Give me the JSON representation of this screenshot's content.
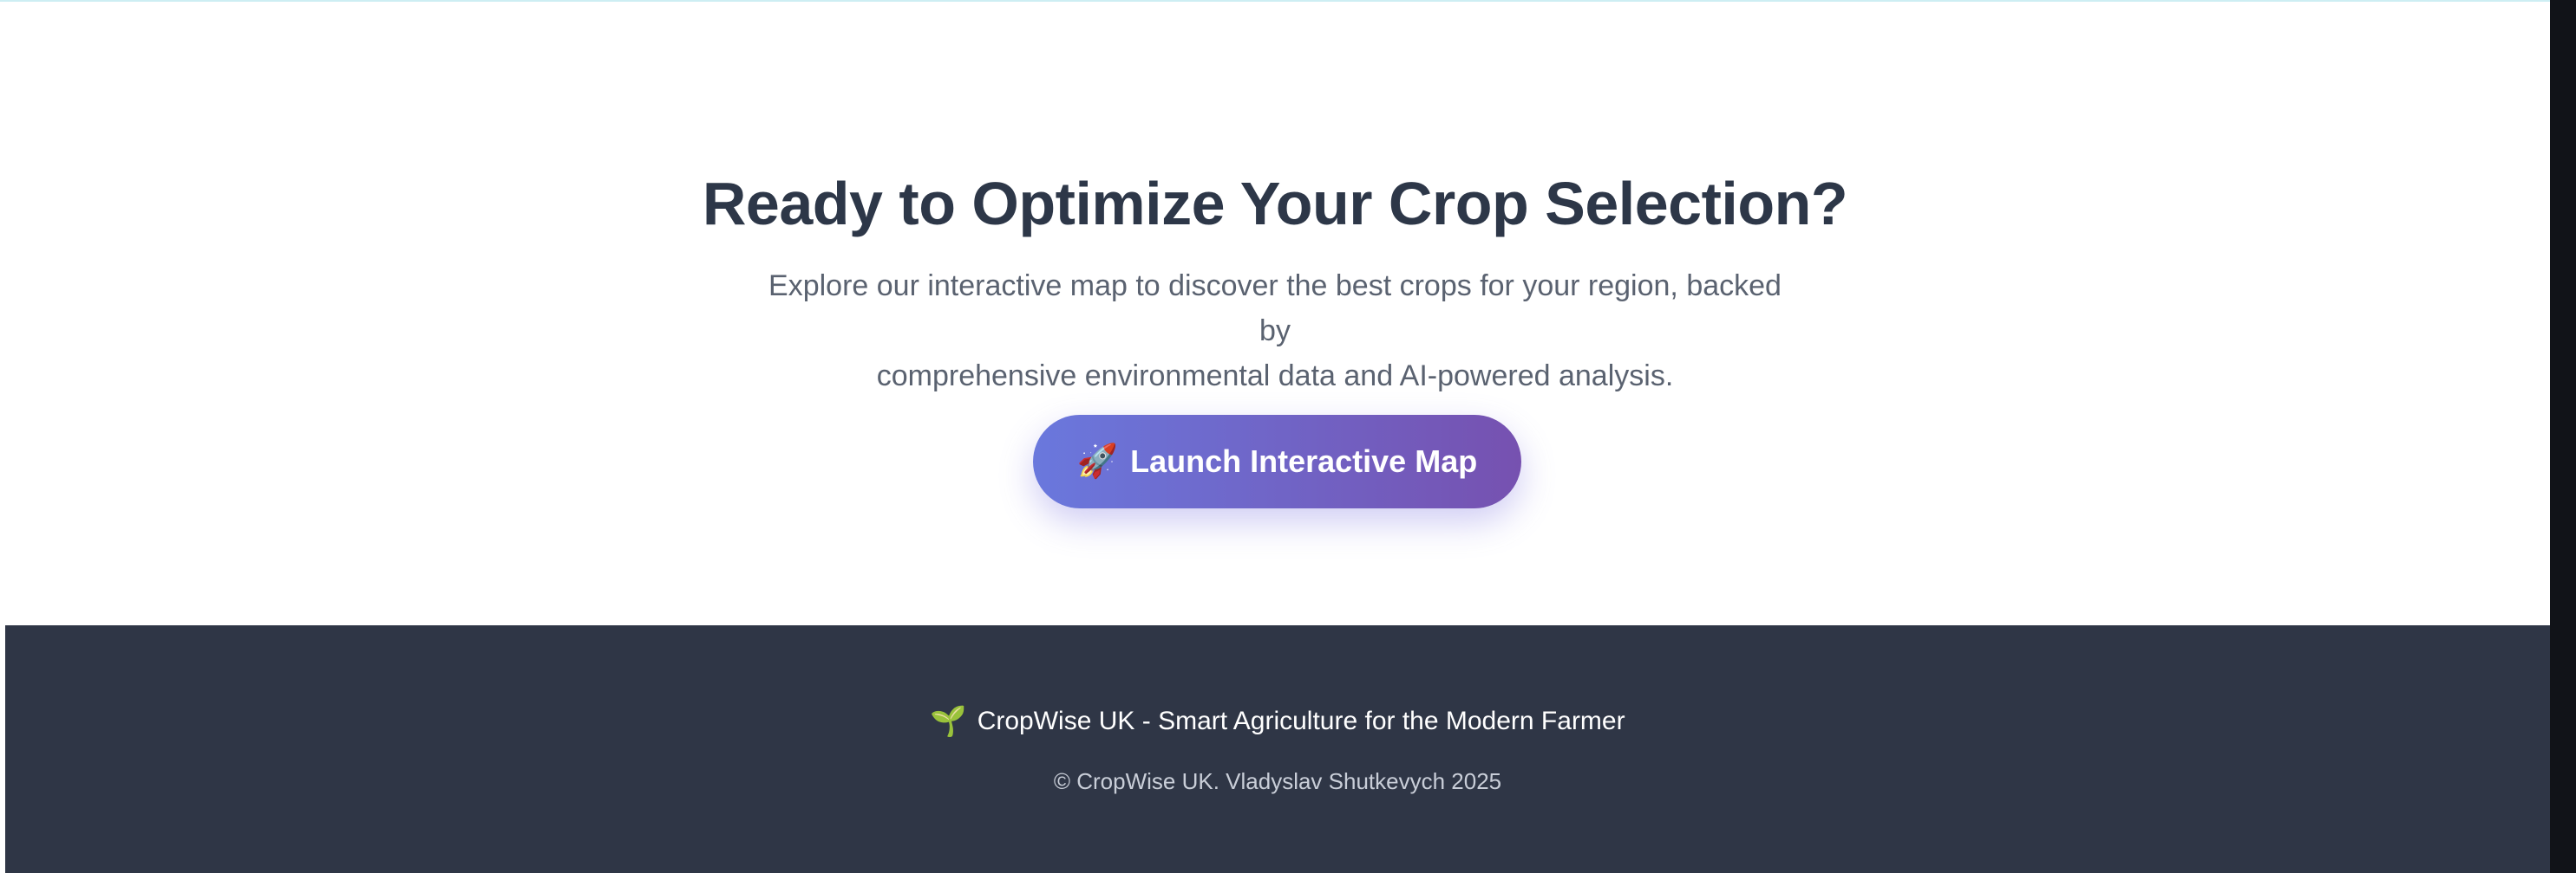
{
  "cta": {
    "title": "Ready to Optimize Your Crop Selection?",
    "description_line1": "Explore our interactive map to discover the best crops for your region, backed by",
    "description_line2": "comprehensive environmental data and AI-powered analysis.",
    "button": {
      "icon": "🚀",
      "icon_name": "rocket-icon",
      "label": "Launch Interactive Map"
    }
  },
  "footer": {
    "icon": "🌱",
    "icon_name": "seedling-icon",
    "brand_text": "CropWise UK - Smart Agriculture for the Modern Farmer",
    "copyright": "© CropWise UK. Vladyslav Shutkevych 2025"
  },
  "colors": {
    "title": "#2d3748",
    "body_text": "#5a6270",
    "button_gradient_start": "#6a78dd",
    "button_gradient_end": "#7651b0",
    "footer_bg": "#2f3646",
    "footer_text": "#ffffff",
    "footer_muted": "#c9ced8"
  }
}
